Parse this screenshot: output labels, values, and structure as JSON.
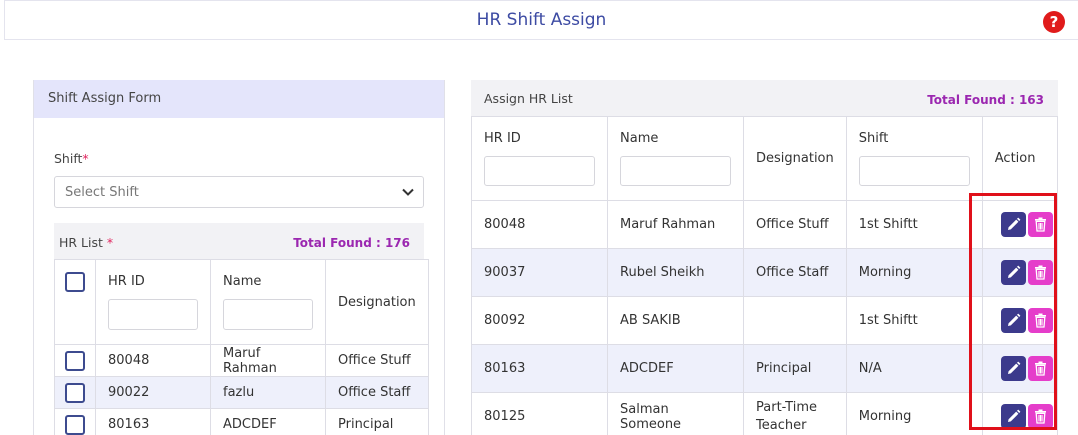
{
  "page": {
    "title": "HR Shift Assign"
  },
  "form": {
    "title": "Shift Assign Form",
    "shift_label": "Shift",
    "required_mark": "*",
    "shift_placeholder": "Select Shift"
  },
  "hr_list": {
    "title": "HR List",
    "required_mark": "*",
    "total": "Total Found : 176",
    "columns": [
      "HR ID",
      "Name",
      "Designation"
    ],
    "rows": [
      {
        "id": "80048",
        "name": "Maruf Rahman",
        "designation": "Office Stuff"
      },
      {
        "id": "90022",
        "name": "fazlu",
        "designation": "Office Staff"
      },
      {
        "id": "80163",
        "name": "ADCDEF",
        "designation": "Principal"
      }
    ]
  },
  "assign_list": {
    "title": "Assign HR List",
    "total": "Total Found : 163",
    "columns": [
      "HR ID",
      "Name",
      "Designation",
      "Shift",
      "Action"
    ],
    "rows": [
      {
        "id": "80048",
        "name": "Maruf Rahman",
        "designation": "Office Stuff",
        "shift": "1st Shiftt"
      },
      {
        "id": "90037",
        "name": "Rubel Sheikh",
        "designation": "Office Staff",
        "shift": "Morning"
      },
      {
        "id": "80092",
        "name": "AB SAKIB",
        "designation": "",
        "shift": "1st Shiftt"
      },
      {
        "id": "80163",
        "name": "ADCDEF",
        "designation": "Principal",
        "shift": "N/A"
      },
      {
        "id": "80125",
        "name": "Salman Someone",
        "designation": "Part-Time Teacher",
        "shift": "Morning"
      }
    ]
  },
  "icons": {
    "help": "help-circle-icon",
    "chevron": "chevron-down-icon",
    "edit": "pencil-icon",
    "delete": "trash-icon"
  },
  "colors": {
    "accent": "#3d4ba3",
    "total": "#9b27b0",
    "edit": "#3c3a8c",
    "delete": "#e53dca",
    "highlight": "#e0101a"
  }
}
